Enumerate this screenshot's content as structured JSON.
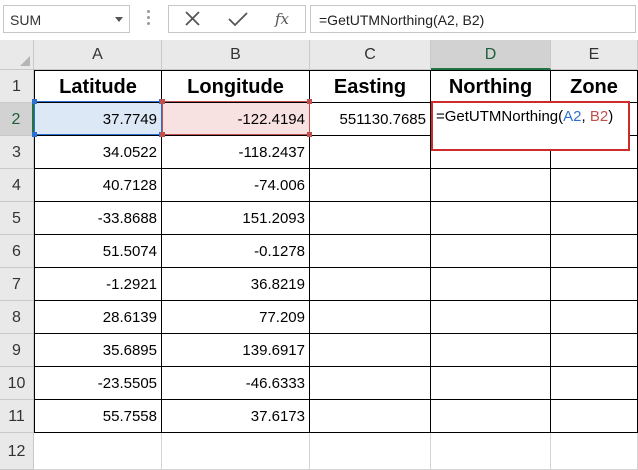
{
  "name_box": {
    "value": "SUM"
  },
  "formula_bar": {
    "cancel_icon": "close-icon",
    "enter_icon": "check-icon",
    "function_label": "fx",
    "formula": "=GetUTMNorthing(A2, B2)"
  },
  "columns": [
    "A",
    "B",
    "C",
    "D",
    "E"
  ],
  "rows": [
    "1",
    "2",
    "3",
    "4",
    "5",
    "6",
    "7",
    "8",
    "9",
    "10",
    "11",
    "12"
  ],
  "headers": {
    "latitude": "Latitude",
    "longitude": "Longitude",
    "easting": "Easting",
    "northing": "Northing",
    "zone": "Zone"
  },
  "data": [
    {
      "lat": "37.7749",
      "lon": "-122.4194",
      "easting": "551130.7685"
    },
    {
      "lat": "34.0522",
      "lon": "-118.2437",
      "easting": ""
    },
    {
      "lat": "40.7128",
      "lon": "-74.006",
      "easting": ""
    },
    {
      "lat": "-33.8688",
      "lon": "151.2093",
      "easting": ""
    },
    {
      "lat": "51.5074",
      "lon": "-0.1278",
      "easting": ""
    },
    {
      "lat": "-1.2921",
      "lon": "36.8219",
      "easting": ""
    },
    {
      "lat": "28.6139",
      "lon": "77.209",
      "easting": ""
    },
    {
      "lat": "35.6895",
      "lon": "139.6917",
      "easting": ""
    },
    {
      "lat": "-23.5505",
      "lon": "-46.6333",
      "easting": ""
    },
    {
      "lat": "55.7558",
      "lon": "37.6173",
      "easting": ""
    }
  ],
  "edit_cell": {
    "prefix": "=GetUTMNorthing(",
    "ref_a": "A2",
    "sep": ", ",
    "ref_b": "B2",
    "suffix": ")"
  },
  "colors": {
    "accent": "#217346",
    "ref_blue": "#2f6fd0",
    "ref_red": "#c0504d",
    "edit_border": "#cf2b2b"
  }
}
